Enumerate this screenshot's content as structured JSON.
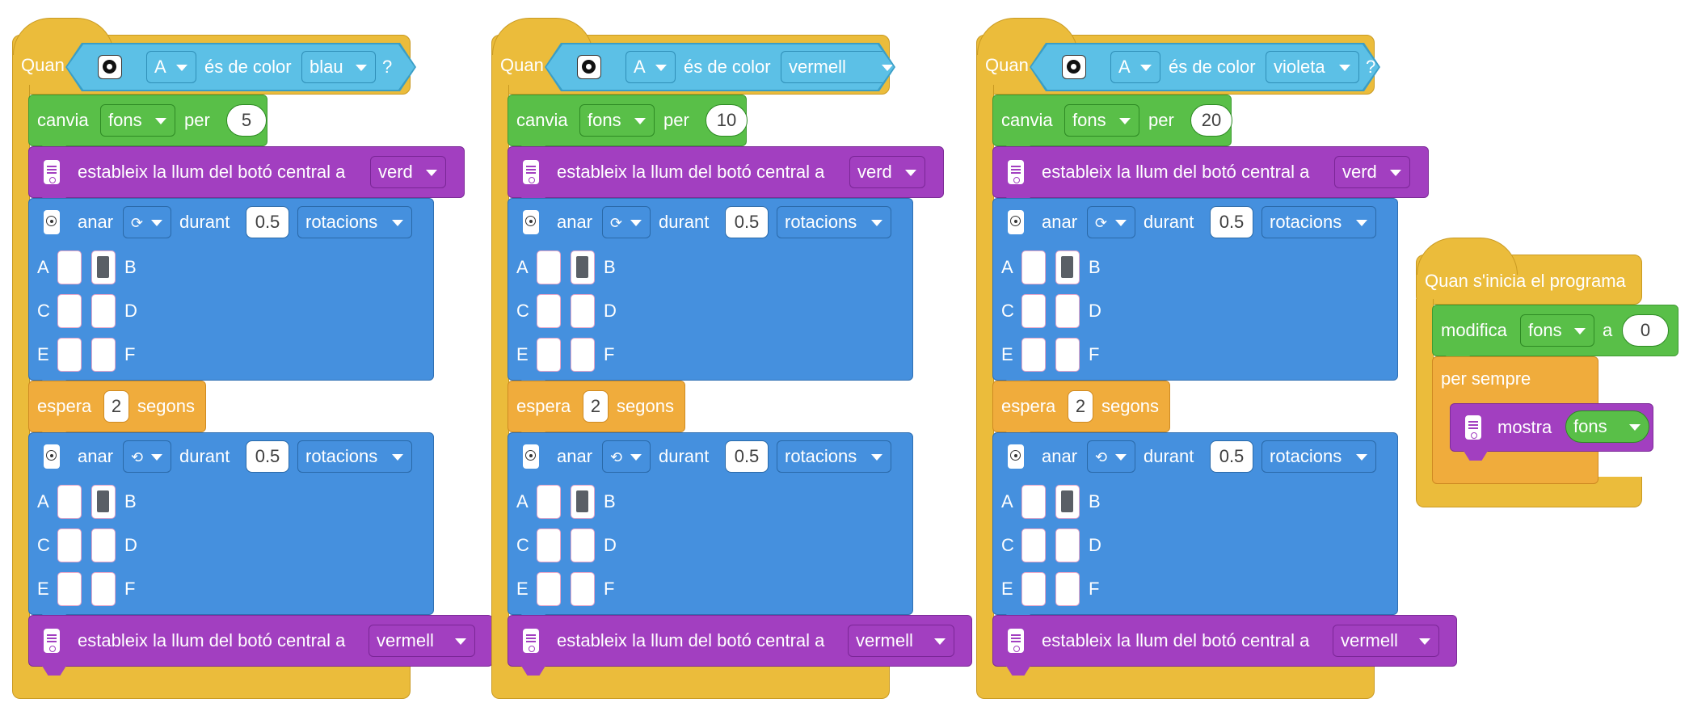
{
  "stacks": [
    {
      "when_label": "Quan",
      "sensor_port": "A",
      "is_color_label": "és de color",
      "color": "blau",
      "question": "?",
      "change_label": "canvia",
      "change_var": "fons",
      "by_label": "per",
      "change_value": "5",
      "light1_label": "estableix la llum del botó central a",
      "light1_value": "verd",
      "run1": {
        "label": "anar",
        "dir_icon": "rotate-clockwise-icon",
        "dir_glyph": "⟳",
        "during": "durant",
        "amount": "0.5",
        "unit": "rotacions"
      },
      "ports": [
        "A",
        "B",
        "C",
        "D",
        "E",
        "F"
      ],
      "wait_label": "espera",
      "wait_value": "2",
      "wait_unit": "segons",
      "run2": {
        "label": "anar",
        "dir_icon": "rotate-counterclockwise-icon",
        "dir_glyph": "⟲",
        "during": "durant",
        "amount": "0.5",
        "unit": "rotacions"
      },
      "light2_label": "estableix la llum del botó central a",
      "light2_value": "vermell"
    },
    {
      "when_label": "Quan",
      "sensor_port": "A",
      "is_color_label": "és de color",
      "color": "vermell",
      "question": "?",
      "change_label": "canvia",
      "change_var": "fons",
      "by_label": "per",
      "change_value": "10",
      "light1_label": "estableix la llum del botó central a",
      "light1_value": "verd",
      "run1": {
        "label": "anar",
        "dir_icon": "rotate-clockwise-icon",
        "dir_glyph": "⟳",
        "during": "durant",
        "amount": "0.5",
        "unit": "rotacions"
      },
      "ports": [
        "A",
        "B",
        "C",
        "D",
        "E",
        "F"
      ],
      "wait_label": "espera",
      "wait_value": "2",
      "wait_unit": "segons",
      "run2": {
        "label": "anar",
        "dir_icon": "rotate-counterclockwise-icon",
        "dir_glyph": "⟲",
        "during": "durant",
        "amount": "0.5",
        "unit": "rotacions"
      },
      "light2_label": "estableix la llum del botó central a",
      "light2_value": "vermell"
    },
    {
      "when_label": "Quan",
      "sensor_port": "A",
      "is_color_label": "és de color",
      "color": "violeta",
      "question": "?",
      "change_label": "canvia",
      "change_var": "fons",
      "by_label": "per",
      "change_value": "20",
      "light1_label": "estableix la llum del botó central a",
      "light1_value": "verd",
      "run1": {
        "label": "anar",
        "dir_icon": "rotate-clockwise-icon",
        "dir_glyph": "⟳",
        "during": "durant",
        "amount": "0.5",
        "unit": "rotacions"
      },
      "ports": [
        "A",
        "B",
        "C",
        "D",
        "E",
        "F"
      ],
      "wait_label": "espera",
      "wait_value": "2",
      "wait_unit": "segons",
      "run2": {
        "label": "anar",
        "dir_icon": "rotate-counterclockwise-icon",
        "dir_glyph": "⟲",
        "during": "durant",
        "amount": "0.5",
        "unit": "rotacions"
      },
      "light2_label": "estableix la llum del botó central a",
      "light2_value": "vermell"
    }
  ],
  "start_stack": {
    "when_label": "Quan s'inicia el programa",
    "set_label": "modifica",
    "set_var": "fons",
    "to_label": "a",
    "set_value": "0",
    "forever_label": "per sempre",
    "display_label": "mostra",
    "display_var": "fons"
  },
  "colors": {
    "events": "#ebbc3b",
    "sensor": "#5cc0e6",
    "variables": "#59bf48",
    "light": "#a23fc0",
    "motors": "#4590de",
    "control": "#f0ac3c"
  }
}
